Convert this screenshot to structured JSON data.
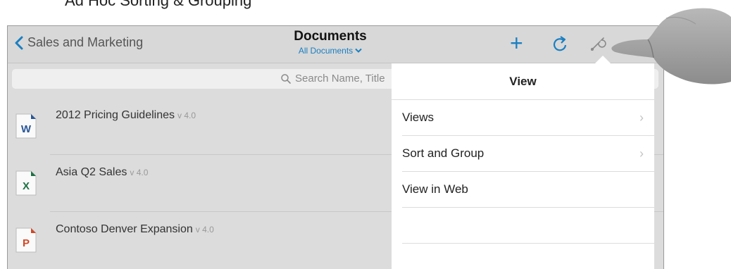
{
  "caption": "Ad Hoc Sorting & Grouping",
  "nav": {
    "back_label": "Sales and Marketing",
    "title": "Documents",
    "subtitle": "All Documents"
  },
  "search": {
    "placeholder": "Search Name, Title"
  },
  "documents": [
    {
      "name": "2012 Pricing Guidelines",
      "version": "v 4.0",
      "type": "word",
      "icon_letter": "W",
      "color": "#2b5797"
    },
    {
      "name": "Asia Q2 Sales",
      "version": "v 4.0",
      "type": "excel",
      "icon_letter": "X",
      "color": "#1e7145"
    },
    {
      "name": "Contoso Denver Expansion",
      "version": "v 4.0",
      "type": "powerpoint",
      "icon_letter": "P",
      "color": "#d24726"
    }
  ],
  "popover": {
    "title": "View",
    "items": [
      {
        "label": "Views",
        "has_chevron": true
      },
      {
        "label": "Sort and Group",
        "has_chevron": true
      },
      {
        "label": "View in Web",
        "has_chevron": false
      }
    ]
  },
  "colors": {
    "accent": "#1a7fc1",
    "nav_background": "#d8d8d8"
  },
  "icons": [
    "back-chevron-icon",
    "chevron-down-icon",
    "plus-icon",
    "refresh-icon",
    "wrench-icon",
    "search-icon",
    "word-doc-icon",
    "excel-doc-icon",
    "powerpoint-doc-icon",
    "chevron-right-icon",
    "hand-pointer-icon"
  ]
}
